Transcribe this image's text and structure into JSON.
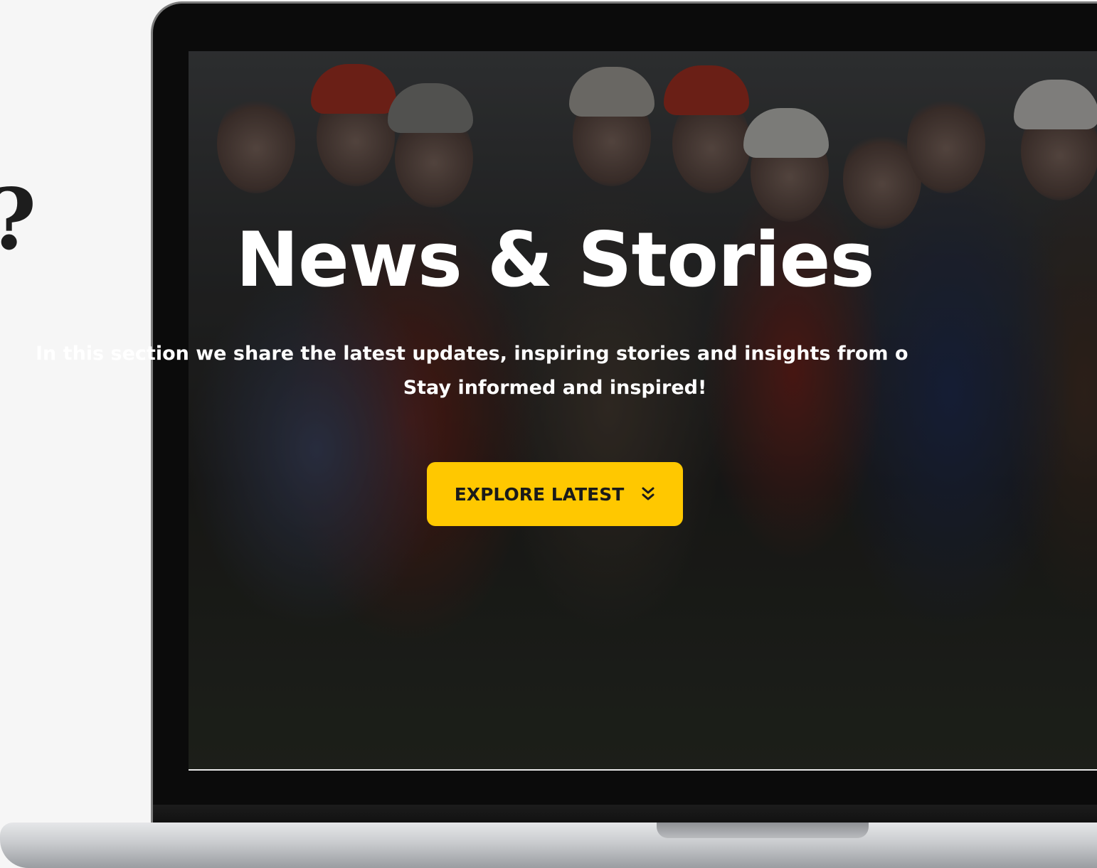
{
  "hero": {
    "title": "News & Stories",
    "subtitle_line1": "In this section we share the latest updates, inspiring stories and insights from o",
    "subtitle_line2": "Stay informed and inspired!",
    "cta_label": "EXPLORE LATEST",
    "cta_icon": "double-chevron-down-icon"
  },
  "side_glyph": "?",
  "colors": {
    "accent": "#ffc800",
    "cta_text": "#1a1a1a",
    "hero_text": "#ffffff",
    "page_background": "#f6f6f6"
  }
}
